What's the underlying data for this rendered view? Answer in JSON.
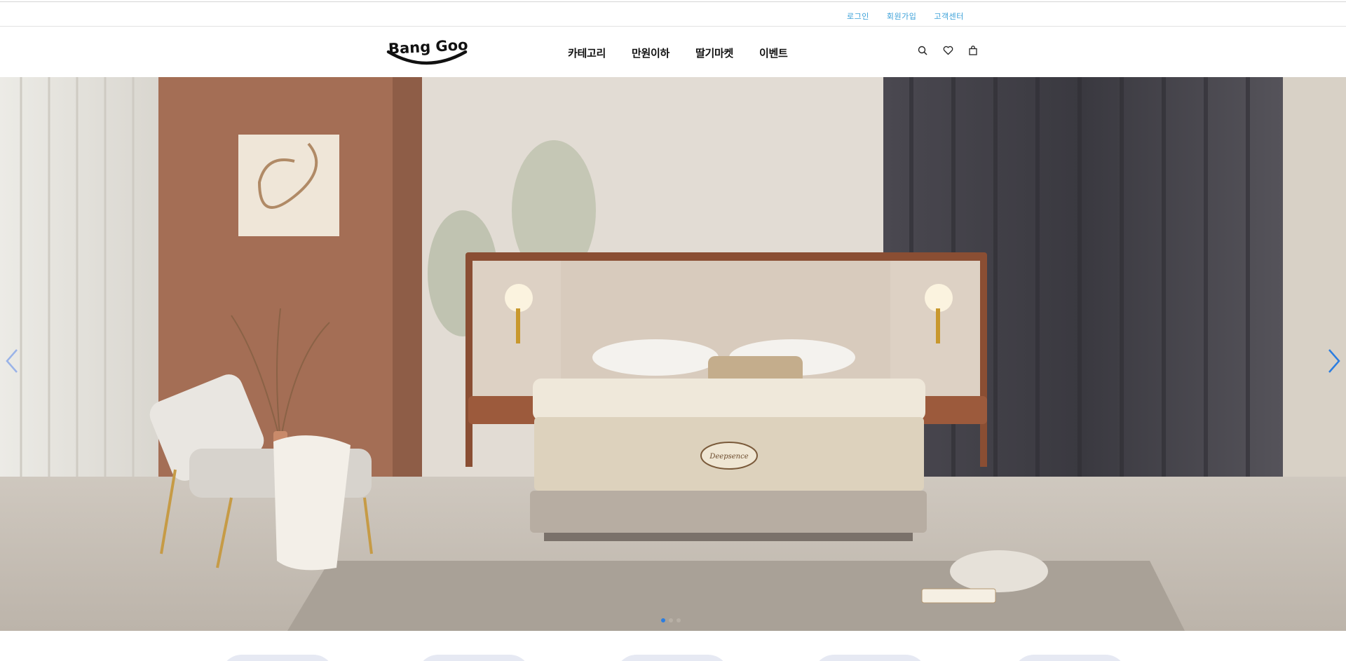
{
  "util_links": [
    "로그인",
    "회원가입",
    "고객센터"
  ],
  "logo": {
    "text": "Bang Good"
  },
  "nav": [
    "카테고리",
    "만원이하",
    "딸기마켓",
    "이벤트"
  ],
  "header_icons": [
    "search-icon",
    "heart-icon",
    "shopping-bag-icon"
  ],
  "hero": {
    "mattress_label": "Deepsence",
    "slides_total": 3,
    "active_slide": 1
  },
  "colors": {
    "util_link": "#3aa0d8",
    "active_dot": "#2b7de0",
    "arrow": "#2b7de0"
  }
}
